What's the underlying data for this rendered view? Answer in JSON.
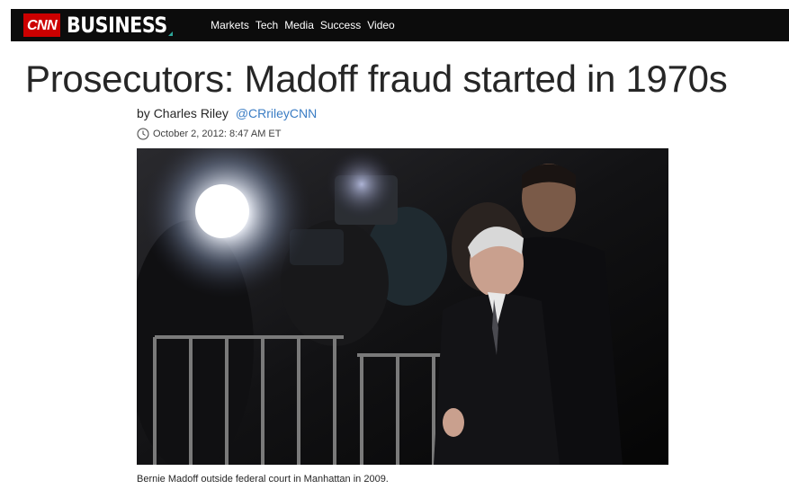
{
  "header": {
    "logo_cnn": "CNN",
    "logo_business": "BUSINESS",
    "nav": [
      {
        "label": "Markets"
      },
      {
        "label": "Tech"
      },
      {
        "label": "Media"
      },
      {
        "label": "Success"
      },
      {
        "label": "Video"
      }
    ]
  },
  "article": {
    "headline": "Prosecutors: Madoff fraud started in 1970s",
    "byline": {
      "prefix": "by",
      "author": "Charles Riley",
      "handle": "@CRrileyCNN"
    },
    "timestamp": "October 2, 2012: 8:47 AM ET",
    "photo_caption": "Bernie Madoff outside federal court in Manhattan in 2009."
  },
  "colors": {
    "cnn_red": "#cc0000",
    "topbar": "#0c0c0c",
    "link_blue": "#3b7dc4",
    "accent_teal": "#2ea89b"
  }
}
